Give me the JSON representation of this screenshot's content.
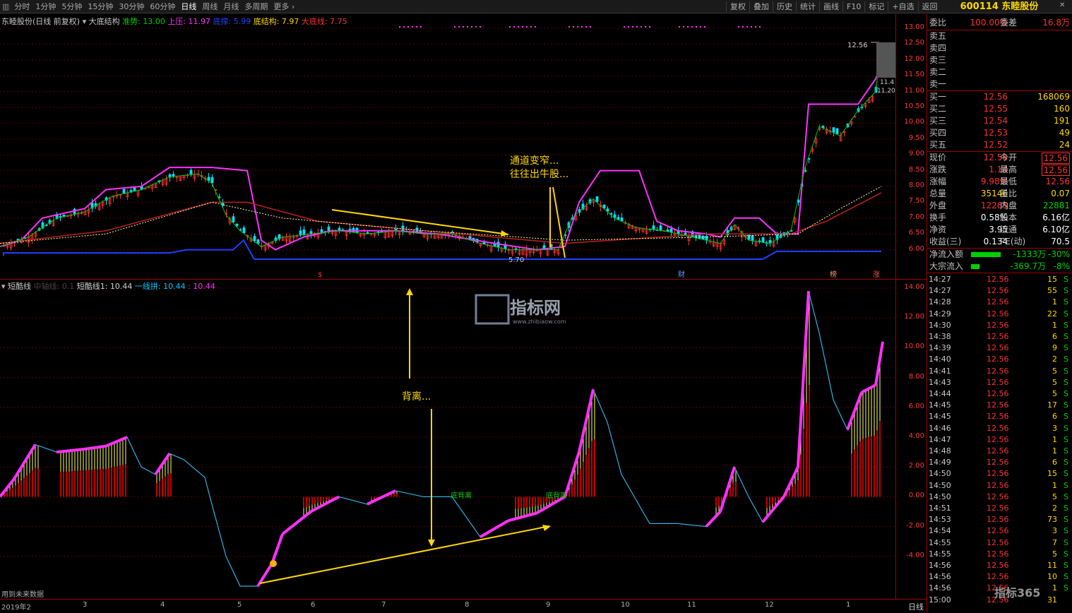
{
  "toolbar": {
    "left_items": [
      "分时",
      "1分钟",
      "5分钟",
      "15分钟",
      "30分钟",
      "60分钟",
      "日线",
      "周线",
      "月线",
      "多周期",
      "更多"
    ],
    "active": "日线",
    "right_items": [
      "复权",
      "叠加",
      "历史",
      "统计",
      "画线",
      "F10",
      "标记",
      "+自选",
      "返回"
    ]
  },
  "stock": {
    "code_name": "600114 东睦股份"
  },
  "legend_main": {
    "title": "东睦股份(日线 前复权)",
    "indicator": "大底结构",
    "items": [
      {
        "label": "准势: 13.00",
        "color": "#00d000"
      },
      {
        "label": "上压: 11.97",
        "color": "#ff30ff"
      },
      {
        "label": "底撑: 5.99",
        "color": "#2040ff"
      },
      {
        "label": "底结构: 7.97",
        "color": "#ffd800"
      },
      {
        "label": "大底线: 7.75",
        "color": "#ff3030"
      }
    ]
  },
  "legend_sub": {
    "indicator": "短酷线",
    "items": [
      {
        "label": "中轴线: 0.1",
        "color": "#444444"
      },
      {
        "label": "短酷线1: 10.44",
        "color": "#d0d0d0"
      },
      {
        "label": "一线拼: 10.44",
        "color": "#00c8ff"
      },
      {
        "label": ": 10.44",
        "color": "#ff30ff"
      }
    ]
  },
  "axis_main": [
    "13.00",
    "12.50",
    "12.00",
    "11.50",
    "11.00",
    "10.50",
    "10.00",
    "9.50",
    "9.00",
    "8.50",
    "8.00",
    "7.50",
    "7.00",
    "6.50",
    "6.00"
  ],
  "axis_sub": [
    "14.00",
    "12.00",
    "10.00",
    "8.00",
    "6.00",
    "4.00",
    "2.00",
    "0.00",
    "-2.00",
    "-4.00"
  ],
  "annotations": {
    "price_high": "12.56",
    "price_low": "5.70",
    "box_a": "11.4",
    "box_b": "11.20",
    "narrow_1": "通道变窄...",
    "narrow_2": "往往出牛股...",
    "divergence": "背离...",
    "bottom_div_1": "底背离",
    "bottom_div_2": "底背离",
    "future_data": "用到未来数据",
    "mark_1": "$",
    "mark_2": "财",
    "mark_3": "榜",
    "mark_4": "涨"
  },
  "dates": [
    "2019年2",
    "3",
    "4",
    "5",
    "6",
    "7",
    "8",
    "9",
    "10",
    "11",
    "12",
    "1"
  ],
  "period_label": "日线",
  "quote": {
    "webi": {
      "label": "委比",
      "value": "100.00%",
      "label2": "委差",
      "value2": "16.8万"
    },
    "sells": [
      {
        "label": "卖五"
      },
      {
        "label": "卖四"
      },
      {
        "label": "卖三"
      },
      {
        "label": "卖二"
      },
      {
        "label": "卖一"
      }
    ],
    "buys": [
      {
        "label": "买一",
        "price": "12.56",
        "vol": "168069"
      },
      {
        "label": "买二",
        "price": "12.55",
        "vol": "160"
      },
      {
        "label": "买三",
        "price": "12.54",
        "vol": "191"
      },
      {
        "label": "买四",
        "price": "12.53",
        "vol": "49"
      },
      {
        "label": "买五",
        "price": "12.52",
        "vol": "24"
      }
    ],
    "stats": [
      {
        "l1": "现价",
        "v1": "12.56",
        "c1": "red",
        "l2": "今开",
        "v2": "12.56",
        "c2": "red",
        "box": true
      },
      {
        "l1": "涨跌",
        "v1": "1.14",
        "c1": "red",
        "l2": "最高",
        "v2": "12.56",
        "c2": "red",
        "box": true
      },
      {
        "l1": "涨幅",
        "v1": "9.98%",
        "c1": "red",
        "l2": "最低",
        "v2": "12.56",
        "c2": "red"
      },
      {
        "l1": "总量",
        "v1": "35146",
        "c1": "yellow",
        "l2": "量比",
        "v2": "0.07",
        "c2": "yellow"
      },
      {
        "l1": "外盘",
        "v1": "12265",
        "c1": "red",
        "l2": "内盘",
        "v2": "22881",
        "c2": "green"
      },
      {
        "l1": "换手",
        "v1": "0.58%",
        "c1": "white",
        "l2": "股本",
        "v2": "6.16亿",
        "c2": "white"
      },
      {
        "l1": "净资",
        "v1": "3.95",
        "c1": "white",
        "l2": "流通",
        "v2": "6.10亿",
        "c2": "white"
      },
      {
        "l1": "收益(三)",
        "v1": "0.134",
        "c1": "white",
        "l2": "PE(动)",
        "v2": "70.5",
        "c2": "white"
      }
    ],
    "flows": [
      {
        "label": "净流入额",
        "value": "-1333万",
        "pct": "-30%",
        "bar": 0.78
      },
      {
        "label": "大宗流入",
        "value": "-369.7万",
        "pct": "-8%",
        "bar": 0.22
      }
    ]
  },
  "ticks": [
    {
      "t": "14:27",
      "p": "12.56",
      "q": "15",
      "s": "S"
    },
    {
      "t": "14:27",
      "p": "12.56",
      "q": "55",
      "s": "S"
    },
    {
      "t": "14:28",
      "p": "12.56",
      "q": "1",
      "s": "S"
    },
    {
      "t": "14:29",
      "p": "12.56",
      "q": "22",
      "s": "S"
    },
    {
      "t": "14:30",
      "p": "12.56",
      "q": "1",
      "s": "S"
    },
    {
      "t": "14:38",
      "p": "12.56",
      "q": "6",
      "s": "S"
    },
    {
      "t": "14:39",
      "p": "12.56",
      "q": "9",
      "s": "S"
    },
    {
      "t": "14:40",
      "p": "12.56",
      "q": "2",
      "s": "S"
    },
    {
      "t": "14:41",
      "p": "12.56",
      "q": "5",
      "s": "S"
    },
    {
      "t": "14:43",
      "p": "12.56",
      "q": "5",
      "s": "S"
    },
    {
      "t": "14:44",
      "p": "12.56",
      "q": "5",
      "s": "S"
    },
    {
      "t": "14:45",
      "p": "12.56",
      "q": "17",
      "s": "S"
    },
    {
      "t": "14:45",
      "p": "12.56",
      "q": "6",
      "s": "S"
    },
    {
      "t": "14:46",
      "p": "12.56",
      "q": "3",
      "s": "S"
    },
    {
      "t": "14:47",
      "p": "12.56",
      "q": "1",
      "s": "S"
    },
    {
      "t": "14:48",
      "p": "12.56",
      "q": "1",
      "s": "S"
    },
    {
      "t": "14:49",
      "p": "12.56",
      "q": "6",
      "s": "S"
    },
    {
      "t": "14:50",
      "p": "12.56",
      "q": "15",
      "s": "S"
    },
    {
      "t": "14:50",
      "p": "12.56",
      "q": "1",
      "s": "S"
    },
    {
      "t": "14:50",
      "p": "12.56",
      "q": "5",
      "s": "S"
    },
    {
      "t": "14:51",
      "p": "12.56",
      "q": "2",
      "s": "S"
    },
    {
      "t": "14:53",
      "p": "12.56",
      "q": "73",
      "s": "S"
    },
    {
      "t": "14:54",
      "p": "12.56",
      "q": "3",
      "s": "S"
    },
    {
      "t": "14:55",
      "p": "12.56",
      "q": "7",
      "s": "S"
    },
    {
      "t": "14:55",
      "p": "12.56",
      "q": "5",
      "s": "S"
    },
    {
      "t": "14:56",
      "p": "12.56",
      "q": "11",
      "s": "S"
    },
    {
      "t": "14:56",
      "p": "12.56",
      "q": "10",
      "s": "S"
    },
    {
      "t": "14:56",
      "p": "12.56",
      "q": "1",
      "s": "S"
    },
    {
      "t": "15:00",
      "p": "12.56",
      "q": "31",
      "s": ""
    }
  ],
  "watermark": {
    "main": "指标网",
    "sub": "www.zhibiaow.com",
    "corner": "指标365"
  }
}
